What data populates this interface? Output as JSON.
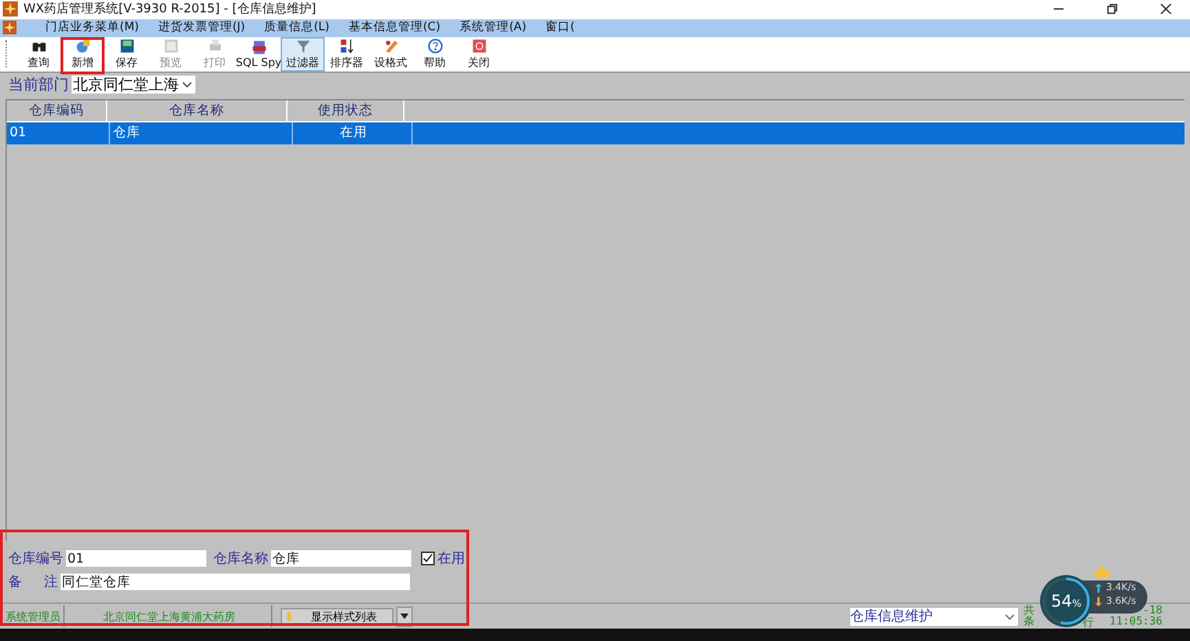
{
  "window": {
    "title": "WX药店管理系统[V-3930 R-2015] - [仓库信息维护]"
  },
  "menu": [
    {
      "label": "门店业务菜单(M)"
    },
    {
      "label": "进货发票管理(J)"
    },
    {
      "label": "质量信息(L)"
    },
    {
      "label": "基本信息管理(C)"
    },
    {
      "label": "系统管理(A)"
    },
    {
      "label": "窗口("
    }
  ],
  "toolbar": [
    {
      "label": "查询",
      "disabled": false,
      "selected": false,
      "highlighted": false
    },
    {
      "label": "新增",
      "disabled": false,
      "selected": false,
      "highlighted": true
    },
    {
      "label": "保存",
      "disabled": false,
      "selected": false,
      "highlighted": false
    },
    {
      "label": "预览",
      "disabled": true,
      "selected": false,
      "highlighted": false
    },
    {
      "label": "打印",
      "disabled": true,
      "selected": false,
      "highlighted": false
    },
    {
      "label": "SQL Spy",
      "disabled": false,
      "selected": false,
      "highlighted": false
    },
    {
      "label": "过滤器",
      "disabled": false,
      "selected": true,
      "highlighted": false
    },
    {
      "label": "排序器",
      "disabled": false,
      "selected": false,
      "highlighted": false
    },
    {
      "label": "设格式",
      "disabled": false,
      "selected": false,
      "highlighted": false
    },
    {
      "label": "帮助",
      "disabled": false,
      "selected": false,
      "highlighted": false
    },
    {
      "label": "关闭",
      "disabled": false,
      "selected": false,
      "highlighted": false
    }
  ],
  "department": {
    "label": "当前部门",
    "value": "北京同仁堂上海"
  },
  "table": {
    "columns": [
      "仓库编码",
      "仓库名称",
      "使用状态"
    ],
    "rows": [
      {
        "cells": [
          "01",
          "仓库",
          "在用"
        ],
        "selected": true
      }
    ]
  },
  "form": {
    "code_label": "仓库编号",
    "code": "01",
    "name_label": "仓库名称",
    "name": "仓库",
    "in_use_label": "在用",
    "in_use": true,
    "note_label_1": "备",
    "note_label_2": "注",
    "note": "同仁堂仓库"
  },
  "status_bar": {
    "user": "系统管理员",
    "store": "北京同仁堂上海黄浦大药房",
    "style_button": "显示样式列表",
    "module": "仓库信息维护",
    "count_1": "共",
    "count_2": "条",
    "count_3": "行",
    "date": "-18",
    "time": "11:05:36"
  },
  "overlay": {
    "percent": "54",
    "unit": "%",
    "upload": "3.4K/s",
    "download": "3.6K/s",
    "level": 0.54
  }
}
